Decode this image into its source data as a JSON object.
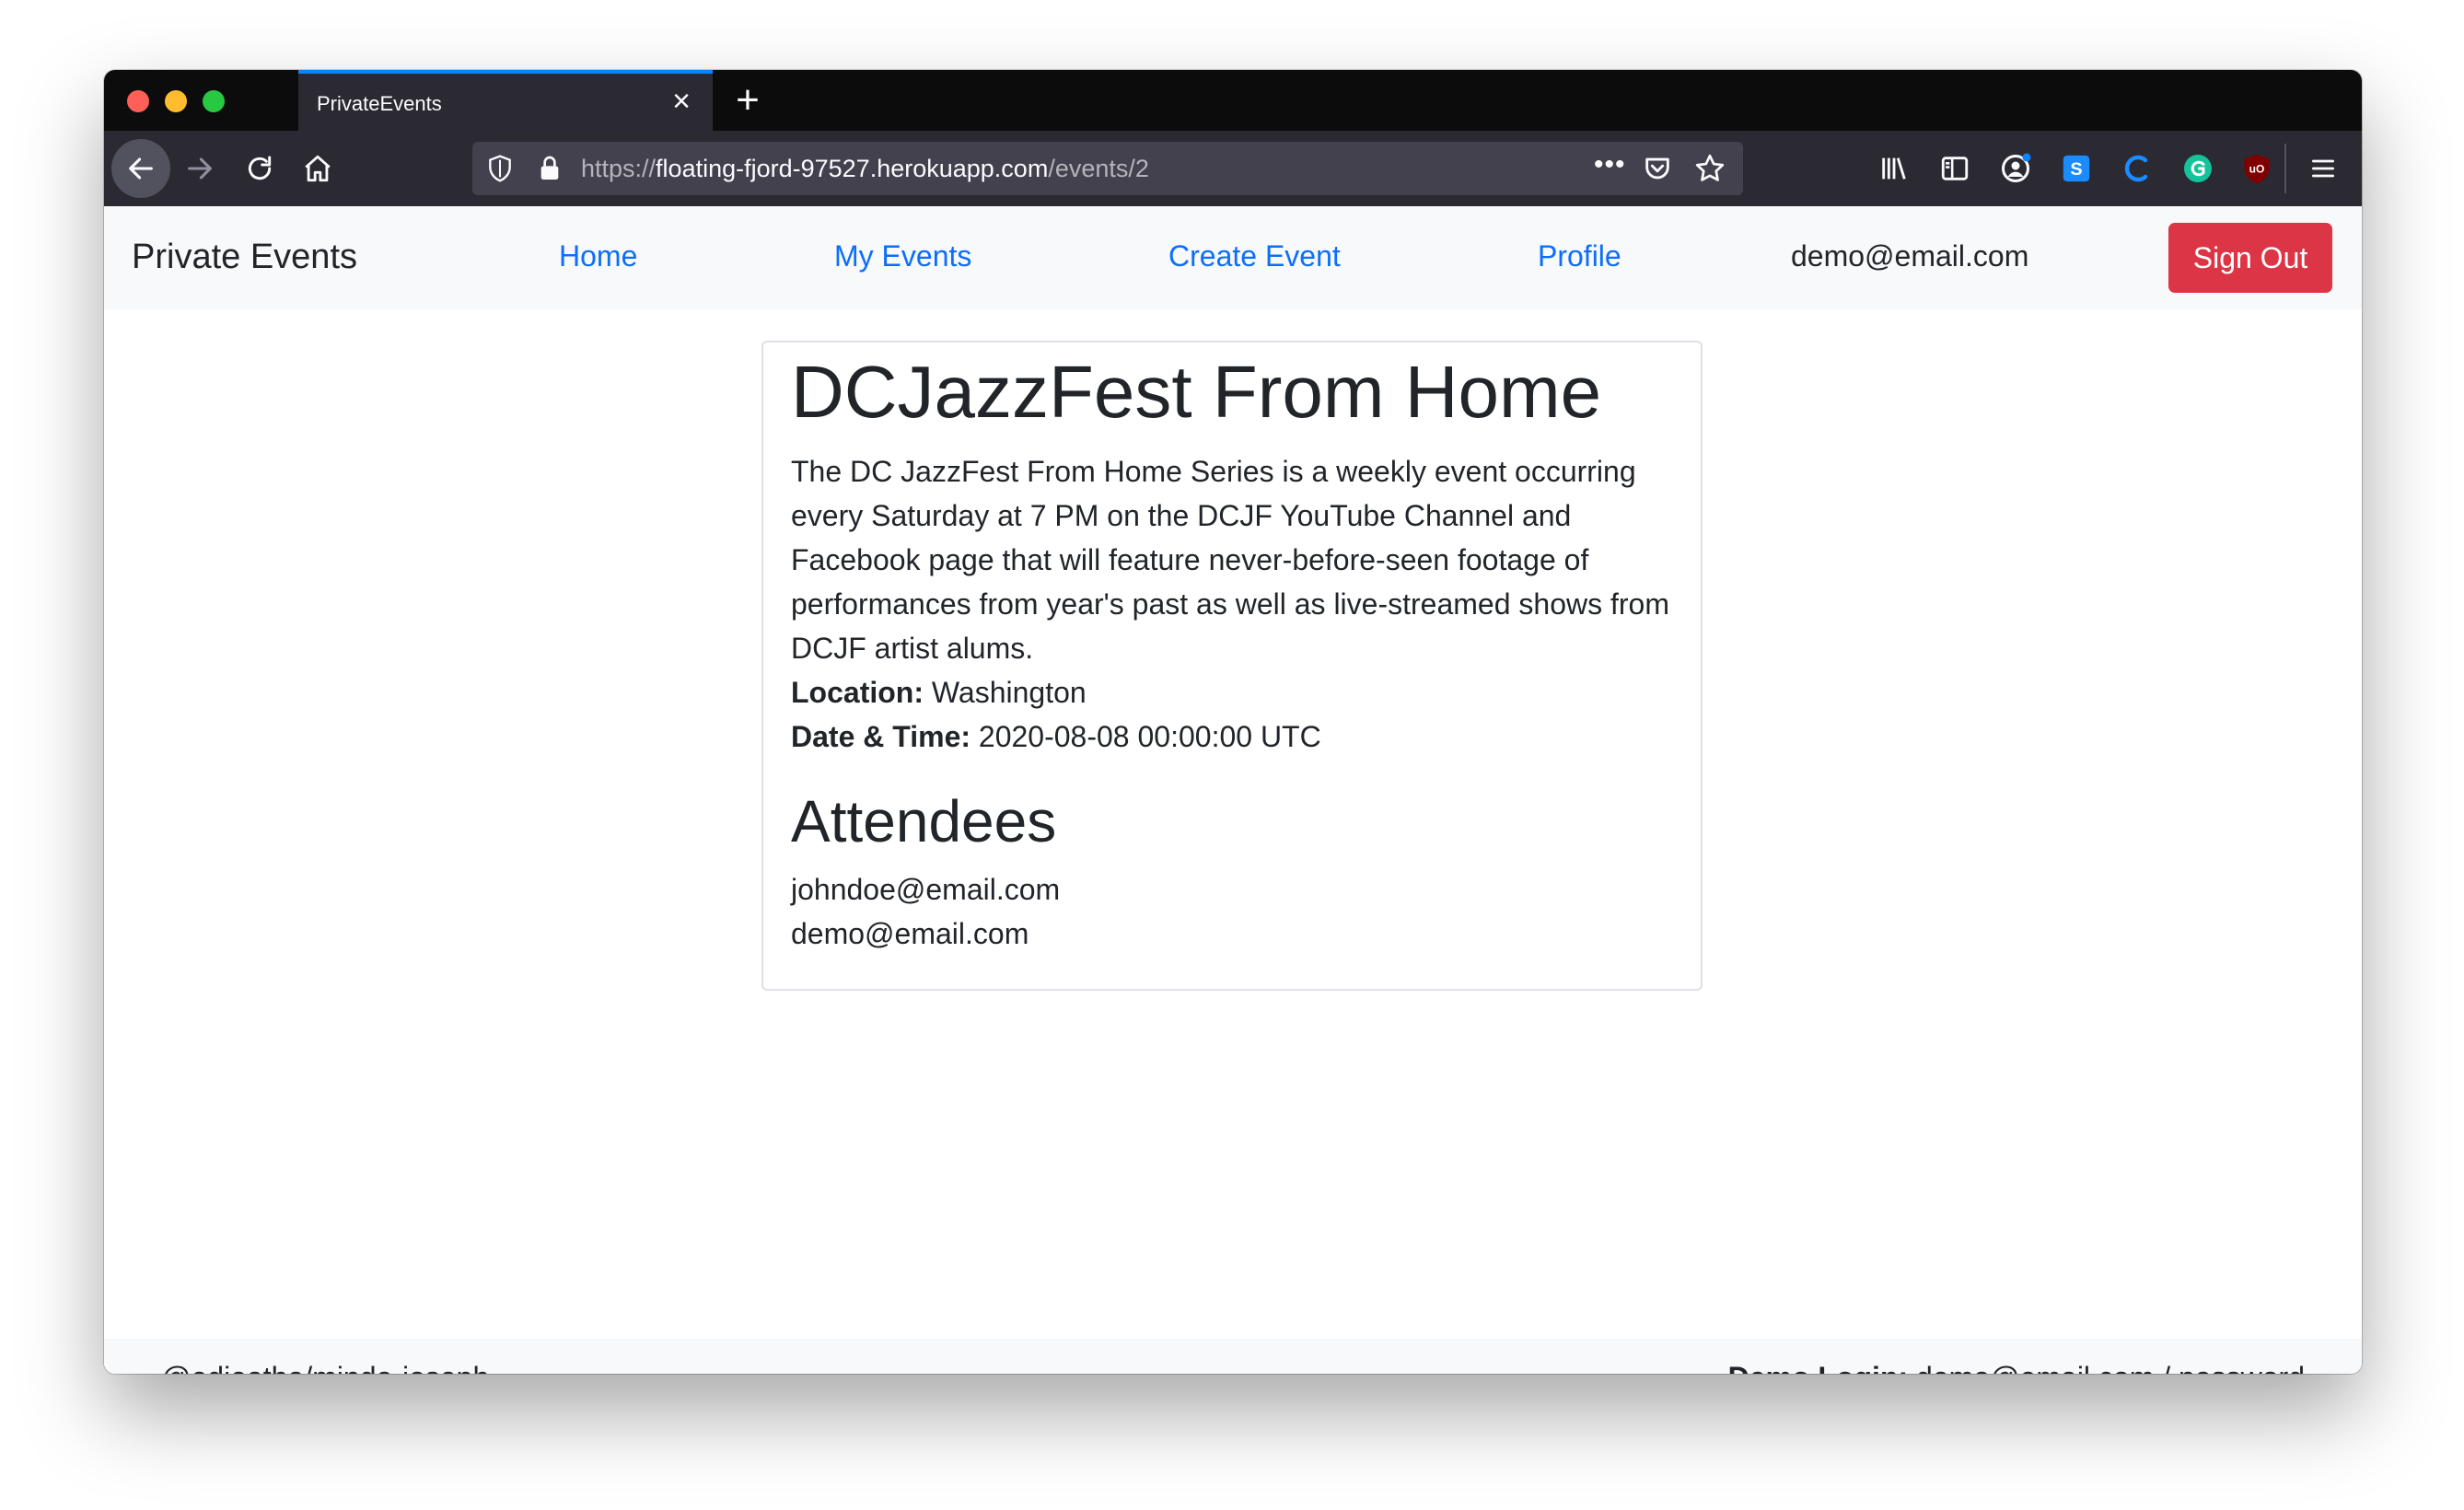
{
  "browser": {
    "tab_title": "PrivateEvents",
    "url_scheme": "https://",
    "url_host": "floating-fjord-97527.herokuapp.com",
    "url_path": "/events/2",
    "icons": [
      "back-arrow-icon",
      "forward-arrow-icon",
      "reload-icon",
      "home-icon",
      "tracking-shield-icon",
      "lock-icon",
      "page-actions-icon",
      "pocket-icon",
      "bookmark-star-icon",
      "library-icon",
      "sidebar-icon",
      "account-icon",
      "extension-s-icon",
      "extension-c-icon",
      "grammarly-icon",
      "ublock-icon",
      "menu-icon"
    ]
  },
  "navbar": {
    "brand": "Private Events",
    "links": [
      "Home",
      "My Events",
      "Create Event",
      "Profile"
    ],
    "user_email": "demo@email.com",
    "sign_out": "Sign Out"
  },
  "event": {
    "title": "DCJazzFest From Home",
    "description": "The DC JazzFest From Home Series is a weekly event occurring every Saturday at 7 PM on the DCJF YouTube Channel and Facebook page that will feature never-before-seen footage of performances from year's past as well as live-streamed shows from DCJF artist alums.",
    "location_label": "Location:",
    "location": "Washington",
    "datetime_label": "Date & Time:",
    "datetime": "2020-08-08 00:00:00 UTC",
    "attendees_heading": "Attendees",
    "attendees": [
      "johndoe@email.com",
      "demo@email.com"
    ]
  },
  "footer": {
    "credit": "@edieatha/mindo-joseph",
    "demo_label": "Demo Login:",
    "demo_value": "demo@email.com / password"
  },
  "colors": {
    "link": "#0d6efd",
    "danger": "#dc3545",
    "navbar_bg": "#f8f9fa",
    "browser_chrome": "#2b2a33"
  }
}
